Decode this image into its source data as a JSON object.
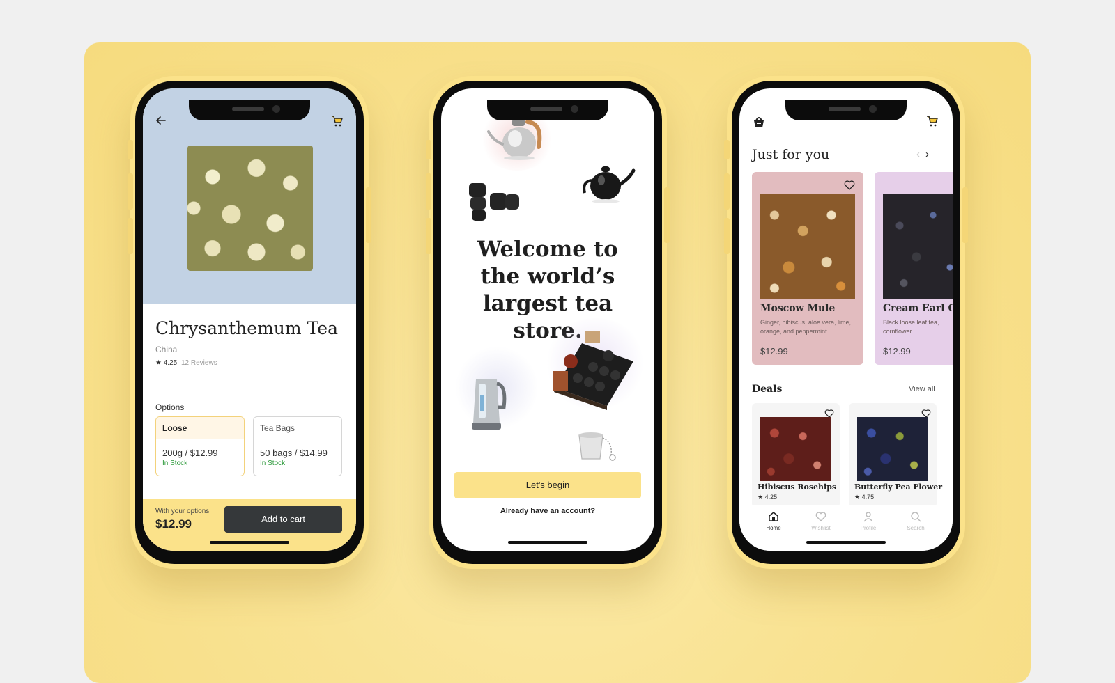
{
  "phone1": {
    "product": {
      "title": "Chrysanthemum Tea",
      "origin": "China",
      "rating": "4.25",
      "reviews": "12 Reviews"
    },
    "options_label": "Options",
    "options": [
      {
        "name": "Loose",
        "price": "200g / $12.99",
        "stock": "In Stock",
        "selected": true
      },
      {
        "name": "Tea Bags",
        "price": "50 bags / $14.99",
        "stock": "In Stock",
        "selected": false
      }
    ],
    "footer": {
      "label": "With your options",
      "price": "$12.99",
      "button": "Add to cart"
    },
    "icons": [
      "back-arrow-icon",
      "cart-icon"
    ],
    "hero_color": "#c2d2e4"
  },
  "phone2": {
    "headline": "Welcome to the world’s largest tea store.",
    "primary_button": "Let's begin",
    "secondary_link": "Already have an account?",
    "illustrations": [
      "kettle-icon",
      "teapot-icon",
      "cups-icon",
      "electric-kettle-icon",
      "tea-tray-icon",
      "tea-infuser-icon"
    ]
  },
  "phone3": {
    "section_title": "Just for you",
    "featured": [
      {
        "name": "Moscow Mule",
        "description": "Ginger, hibiscus, aloe vera, lime, orange, and peppermint.",
        "price": "$12.99",
        "bg": "#e2bcbf"
      },
      {
        "name": "Cream Earl Grey",
        "description": "Black loose leaf tea, cornflower",
        "price": "$12.99",
        "bg": "#e6cfe9"
      }
    ],
    "deals_title": "Deals",
    "view_all": "View all",
    "deals": [
      {
        "name": "Hibiscus Rosehips",
        "rating": "4.25"
      },
      {
        "name": "Butterfly Pea Flower",
        "rating": "4.75"
      }
    ],
    "nav": [
      {
        "label": "Home",
        "icon": "home-icon",
        "active": true
      },
      {
        "label": "Wishlist",
        "icon": "heart-icon",
        "active": false
      },
      {
        "label": "Profile",
        "icon": "user-icon",
        "active": false
      },
      {
        "label": "Search",
        "icon": "search-icon",
        "active": false
      }
    ]
  },
  "colors": {
    "accent_yellow": "#fbe28a",
    "dark_button": "#35383a",
    "in_stock_green": "#2e9a3c"
  }
}
